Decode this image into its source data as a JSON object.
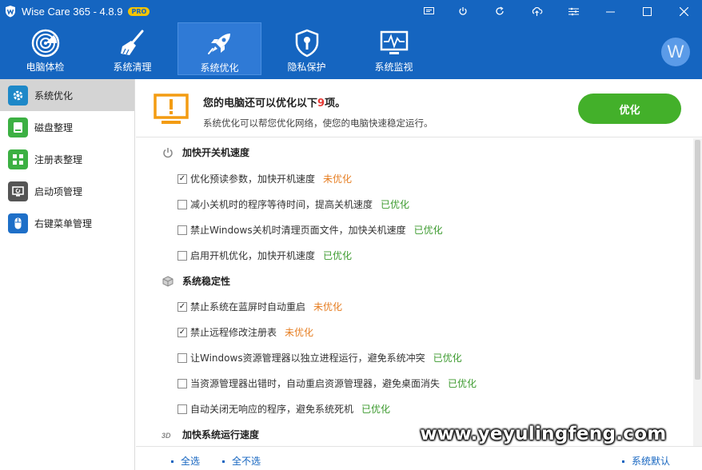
{
  "app": {
    "title": "Wise Care 365 - 4.8.9",
    "badge": "PRO"
  },
  "window_controls": [
    "monitor-icon",
    "power-icon",
    "refresh-icon",
    "cloud-icon",
    "menu-icon",
    "minimize-icon",
    "maximize-icon",
    "close-icon"
  ],
  "topnav": [
    {
      "label": "电脑体检",
      "icon": "radar-icon",
      "active": false
    },
    {
      "label": "系统清理",
      "icon": "broom-icon",
      "active": false
    },
    {
      "label": "系统优化",
      "icon": "rocket-icon",
      "active": true
    },
    {
      "label": "隐私保护",
      "icon": "shield-lock-icon",
      "active": false
    },
    {
      "label": "系统监视",
      "icon": "monitor-pulse-icon",
      "active": false
    }
  ],
  "user": {
    "avatar_letter": "W"
  },
  "sidebar": [
    {
      "label": "系统优化",
      "icon": "gear-icon",
      "color": "#1e88c8",
      "active": true
    },
    {
      "label": "磁盘整理",
      "icon": "disk-icon",
      "color": "#3cb043",
      "active": false
    },
    {
      "label": "注册表整理",
      "icon": "registry-icon",
      "color": "#3cb043",
      "active": false
    },
    {
      "label": "启动项管理",
      "icon": "startup-icon",
      "color": "#555555",
      "active": false
    },
    {
      "label": "右键菜单管理",
      "icon": "mouse-icon",
      "color": "#1e6fc8",
      "active": false
    }
  ],
  "banner": {
    "title_prefix": "您的电脑还可以优化以下",
    "count": "9",
    "title_suffix": "项。",
    "subtitle": "系统优化可以帮您优化网络，使您的电脑快速稳定运行。",
    "button": "优化"
  },
  "sections": [
    {
      "title": "加快开关机速度",
      "icon": "power-icon",
      "items": [
        {
          "label": "优化预读参数，加快开机速度",
          "checked": true,
          "status": "未优化",
          "state": "pending"
        },
        {
          "label": "减小关机时的程序等待时间，提高关机速度",
          "checked": false,
          "status": "已优化",
          "state": "done"
        },
        {
          "label": "禁止Windows关机时清理页面文件，加快关机速度",
          "checked": false,
          "status": "已优化",
          "state": "done"
        },
        {
          "label": "启用开机优化，加快开机速度",
          "checked": false,
          "status": "已优化",
          "state": "done"
        }
      ]
    },
    {
      "title": "系统稳定性",
      "icon": "cube-icon",
      "items": [
        {
          "label": "禁止系统在蓝屏时自动重启",
          "checked": true,
          "status": "未优化",
          "state": "pending"
        },
        {
          "label": "禁止远程修改注册表",
          "checked": true,
          "status": "未优化",
          "state": "pending"
        },
        {
          "label": "让Windows资源管理器以独立进程运行，避免系统冲突",
          "checked": false,
          "status": "已优化",
          "state": "done"
        },
        {
          "label": "当资源管理器出错时，自动重启资源管理器，避免桌面消失",
          "checked": false,
          "status": "已优化",
          "state": "done"
        },
        {
          "label": "自动关闭无响应的程序，避免系统死机",
          "checked": false,
          "status": "已优化",
          "state": "done"
        }
      ]
    },
    {
      "title": "加快系统运行速度",
      "icon": "3d-icon",
      "items": []
    }
  ],
  "footer": {
    "select_all": "全选",
    "select_none": "全不选",
    "default": "系统默认"
  },
  "watermark": "www.yeyulingfeng.com"
}
